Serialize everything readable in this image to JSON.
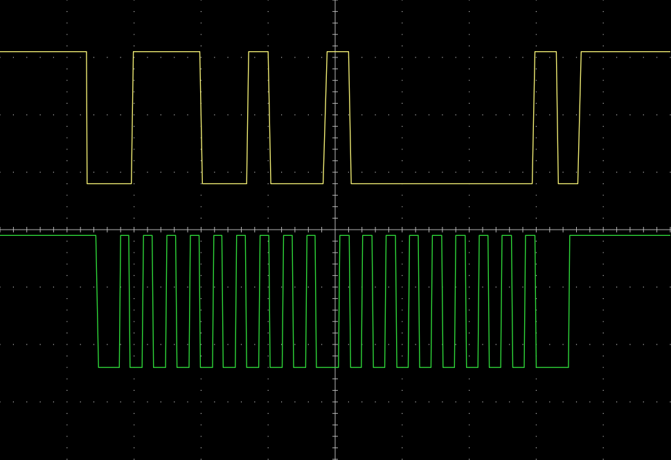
{
  "chart_data": {
    "type": "line",
    "title": "",
    "xlabel": "",
    "ylabel": "",
    "grid": true,
    "grid_style": "dotted graticule",
    "x_divisions": 10,
    "y_divisions": 8,
    "xlim": [
      0,
      10
    ],
    "ylim": [
      -4,
      4
    ],
    "colors": {
      "background": "#000000",
      "graticule": "#b8b8b8",
      "ch1": "#f2ee74",
      "ch2": "#2fd93a"
    },
    "series": [
      {
        "name": "",
        "channel": 1,
        "color": "#f2ee74",
        "points": [
          [
            0.0,
            3.1
          ],
          [
            1.29,
            3.1
          ],
          [
            1.3,
            0.8
          ],
          [
            1.96,
            0.8
          ],
          [
            1.99,
            3.1
          ],
          [
            2.98,
            3.1
          ],
          [
            3.02,
            0.8
          ],
          [
            3.68,
            0.8
          ],
          [
            3.71,
            3.1
          ],
          [
            4.0,
            3.1
          ],
          [
            4.04,
            0.8
          ],
          [
            4.82,
            0.8
          ],
          [
            4.88,
            3.1
          ],
          [
            5.2,
            3.1
          ],
          [
            5.24,
            0.8
          ],
          [
            7.94,
            0.8
          ],
          [
            7.98,
            3.1
          ],
          [
            8.3,
            3.1
          ],
          [
            8.33,
            0.8
          ],
          [
            8.62,
            0.8
          ],
          [
            8.67,
            3.1
          ],
          [
            10.0,
            3.1
          ]
        ]
      },
      {
        "name": "",
        "channel": 2,
        "color": "#2fd93a",
        "points": [
          [
            0.0,
            -0.1
          ],
          [
            1.28,
            -0.1
          ],
          [
            1.43,
            -0.1
          ],
          [
            1.47,
            -2.4
          ],
          [
            1.78,
            -2.4
          ],
          [
            1.8,
            -0.1
          ],
          [
            1.92,
            -0.1
          ],
          [
            1.94,
            -2.4
          ],
          [
            2.12,
            -2.4
          ],
          [
            2.14,
            -0.1
          ],
          [
            2.27,
            -0.1
          ],
          [
            2.29,
            -2.4
          ],
          [
            2.47,
            -2.4
          ],
          [
            2.49,
            -0.1
          ],
          [
            2.62,
            -0.1
          ],
          [
            2.64,
            -2.4
          ],
          [
            2.82,
            -2.4
          ],
          [
            2.84,
            -0.1
          ],
          [
            2.97,
            -0.1
          ],
          [
            2.99,
            -2.4
          ],
          [
            3.17,
            -2.4
          ],
          [
            3.19,
            -0.1
          ],
          [
            3.31,
            -0.1
          ],
          [
            3.33,
            -2.4
          ],
          [
            3.51,
            -2.4
          ],
          [
            3.53,
            -0.1
          ],
          [
            3.66,
            -0.1
          ],
          [
            3.68,
            -2.4
          ],
          [
            3.86,
            -2.4
          ],
          [
            3.88,
            -0.1
          ],
          [
            4.01,
            -0.1
          ],
          [
            4.03,
            -2.4
          ],
          [
            4.21,
            -2.4
          ],
          [
            4.23,
            -0.1
          ],
          [
            4.36,
            -0.1
          ],
          [
            4.38,
            -2.4
          ],
          [
            4.56,
            -2.4
          ],
          [
            4.58,
            -0.1
          ],
          [
            4.7,
            -0.1
          ],
          [
            4.72,
            -2.4
          ],
          [
            4.92,
            -2.4
          ],
          [
            4.94,
            -2.4
          ],
          [
            5.05,
            -2.4
          ],
          [
            5.07,
            -0.1
          ],
          [
            5.21,
            -0.1
          ],
          [
            5.23,
            -2.4
          ],
          [
            5.39,
            -2.4
          ],
          [
            5.41,
            -0.1
          ],
          [
            5.55,
            -0.1
          ],
          [
            5.57,
            -2.4
          ],
          [
            5.74,
            -2.4
          ],
          [
            5.76,
            -0.1
          ],
          [
            5.9,
            -0.1
          ],
          [
            5.92,
            -2.4
          ],
          [
            6.09,
            -2.4
          ],
          [
            6.11,
            -0.1
          ],
          [
            6.24,
            -0.1
          ],
          [
            6.26,
            -2.4
          ],
          [
            6.43,
            -2.4
          ],
          [
            6.45,
            -0.1
          ],
          [
            6.59,
            -0.1
          ],
          [
            6.61,
            -2.4
          ],
          [
            6.78,
            -2.4
          ],
          [
            6.8,
            -0.1
          ],
          [
            6.94,
            -0.1
          ],
          [
            6.96,
            -2.4
          ],
          [
            7.13,
            -2.4
          ],
          [
            7.15,
            -0.1
          ],
          [
            7.28,
            -0.1
          ],
          [
            7.3,
            -2.4
          ],
          [
            7.47,
            -2.4
          ],
          [
            7.49,
            -0.1
          ],
          [
            7.63,
            -0.1
          ],
          [
            7.65,
            -2.4
          ],
          [
            7.82,
            -2.4
          ],
          [
            7.84,
            -0.1
          ],
          [
            7.98,
            -0.1
          ],
          [
            8.0,
            -2.4
          ],
          [
            8.48,
            -2.4
          ],
          [
            8.5,
            -0.1
          ],
          [
            10.0,
            -0.1
          ]
        ]
      }
    ]
  }
}
